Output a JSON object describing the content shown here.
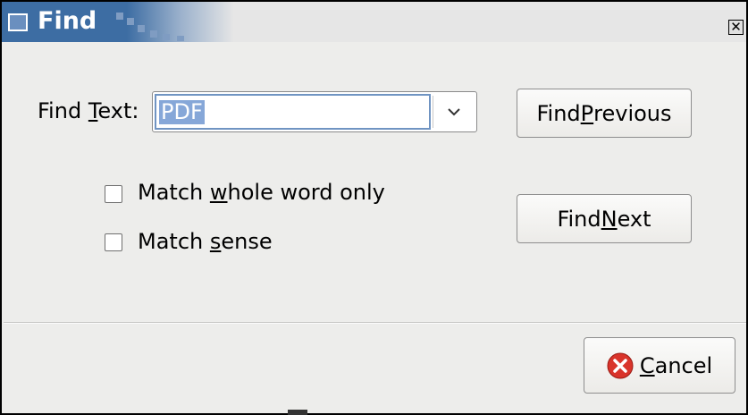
{
  "window": {
    "title": "Find",
    "close_glyph": "✕"
  },
  "find_text": {
    "label_pre": "Find ",
    "label_mnemonic": "T",
    "label_post": "ext:",
    "value": "PDF",
    "dropdown_icon": "chevron-down-icon"
  },
  "options": {
    "whole_word": {
      "pre": "Match ",
      "mnemonic": "w",
      "post": "hole word only",
      "checked": false
    },
    "match_sense": {
      "pre": "Match ",
      "mnemonic": "s",
      "post": "ense",
      "checked": false
    }
  },
  "buttons": {
    "find_previous": {
      "pre": "Find ",
      "mnemonic": "P",
      "post": "revious"
    },
    "find_next": {
      "pre": "Find ",
      "mnemonic": "N",
      "post": "ext"
    },
    "cancel": {
      "pre": "",
      "mnemonic": "C",
      "post": "ancel",
      "icon": "cancel-icon"
    }
  },
  "colors": {
    "title_bar": "#3d6da3",
    "selection": "#86a7d8",
    "cancel_icon": "#d9342b"
  }
}
